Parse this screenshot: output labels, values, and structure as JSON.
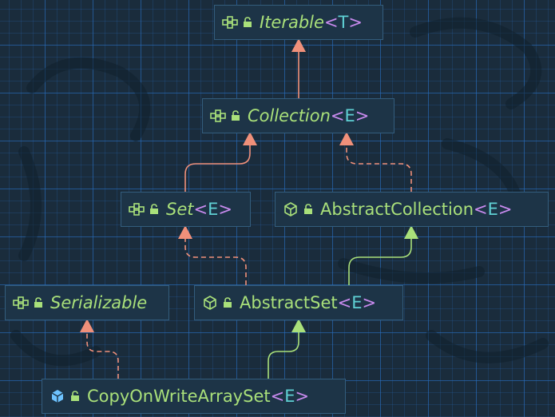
{
  "nodes": [
    {
      "id": "iterable",
      "name": "Iterable",
      "type_param": "T",
      "kind": "interface",
      "italic": true
    },
    {
      "id": "collection",
      "name": "Collection",
      "type_param": "E",
      "kind": "interface",
      "italic": true
    },
    {
      "id": "set",
      "name": "Set",
      "type_param": "E",
      "kind": "interface",
      "italic": true
    },
    {
      "id": "abstract_collection",
      "name": "AbstractCollection",
      "type_param": "E",
      "kind": "abstract-class",
      "italic": false
    },
    {
      "id": "serializable",
      "name": "Serializable",
      "type_param": "",
      "kind": "interface",
      "italic": true
    },
    {
      "id": "abstract_set",
      "name": "AbstractSet",
      "type_param": "E",
      "kind": "abstract-class",
      "italic": false
    },
    {
      "id": "cow_set",
      "name": "CopyOnWriteArraySet",
      "type_param": "E",
      "kind": "class",
      "italic": false
    }
  ],
  "edges": [
    {
      "from": "collection",
      "to": "iterable",
      "type": "extends"
    },
    {
      "from": "set",
      "to": "collection",
      "type": "extends"
    },
    {
      "from": "abstract_collection",
      "to": "collection",
      "type": "implements"
    },
    {
      "from": "abstract_set",
      "to": "set",
      "type": "implements"
    },
    {
      "from": "abstract_set",
      "to": "abstract_collection",
      "type": "extends-class"
    },
    {
      "from": "cow_set",
      "to": "serializable",
      "type": "implements"
    },
    {
      "from": "cow_set",
      "to": "abstract_set",
      "type": "extends-class"
    }
  ],
  "colors": {
    "interface_edge": "#f0907a",
    "class_edge": "#a9e07a",
    "label": "#a9e07a",
    "bracket": "#c88aee",
    "type_var": "#5fd0d4",
    "interface_icon": "#a9e07a",
    "class_icon": "#6ec3ff",
    "grid": "#286ebe",
    "background": "#1a2c3c"
  },
  "icons": {
    "interface": "interface-icon",
    "abstract-class": "abstract-class-icon",
    "class": "class-icon",
    "visibility": "public-lock-icon"
  }
}
